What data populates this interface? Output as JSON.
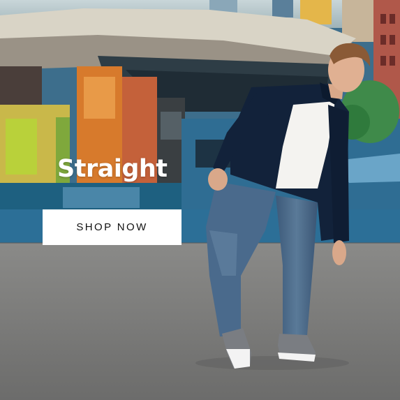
{
  "promo": {
    "headline": "Straight",
    "cta_label": "SHOP NOW"
  },
  "colors": {
    "cta_background": "#ffffff",
    "cta_text": "#111111",
    "headline_text": "#ffffff",
    "floor": "#7b7b7a"
  }
}
